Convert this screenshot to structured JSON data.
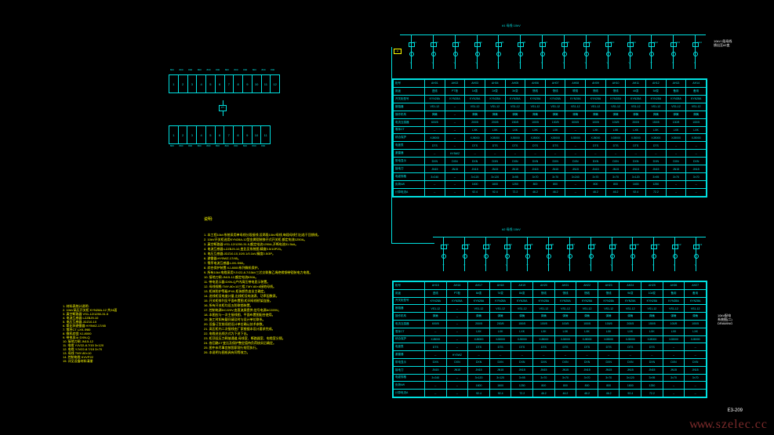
{
  "sheet_no": "E3-209",
  "watermark": "www.szelec.cc",
  "busbar1_title": "#1 母线   10kV",
  "busbar2_title": "#2 母线   10kV",
  "side_title": "10kV配电\n系统图(二)\nDRAWING",
  "panel_top_cells": [
    "1",
    "2",
    "3",
    "4",
    "5",
    "6",
    "7",
    "8",
    "9",
    "10",
    "11",
    "12"
  ],
  "panel_bot_cells": [
    "1",
    "2",
    "3",
    "4",
    "5",
    "6",
    "7",
    "8",
    "9",
    "10",
    "11"
  ],
  "panel_top_dims": [
    "800",
    "800",
    "800",
    "800",
    "800",
    "800",
    "800",
    "800",
    "800",
    "800",
    "800",
    "800"
  ],
  "panel_bot_dims": [
    "800",
    "800",
    "800",
    "800",
    "800",
    "800",
    "800",
    "800",
    "800",
    "800",
    "800"
  ],
  "panel_center": "PT",
  "notes_header": "说明:",
  "notes_lines": [
    "1. 本工程10kV系统采用单母线分段接线,设两段10kV母线,每段母线引出若干回馈线。",
    "2. 10kV开关柜选用KYN28A-12型金属铠装移开式开关柜,额定电流1250A。",
    "3. 真空断路器:VS1-12/1250-31.5,额定电流1250A,开断电流31.5kA。",
    "4. 电流互感器:LZZBJ9-10,变比见系统图,精度0.5/10P20。",
    "5. 电压互感器:JDZ10-10,10/0.1/0.1kV,精度0.5/3P。",
    "6. 避雷器:HY5WZ-17/45。",
    "7. 零序电流互感器:LXK-Φ80。",
    "8. 综合保护装置:XJ-8000系列微机保护。",
    "9. 所有10kV电缆采用YJV22-8.7/15kV三芯交联聚乙烯绝缘钢带铠装电力电缆。",
    "10. 接地刀闸:JN15-12,额定电流630A。",
    "11. 带电显示器:DXN-Q户内高压带电显示装置。",
    "12. 母线规格:TMY-80×10三相,TMY-60×6接地母线。",
    "13. 柜体防护等级IP4X,柜体颜色由业主确定。",
    "14. 进线柜设电度计量,出线柜设电流表、功率因数表。",
    "15. 开关柜排列见平面布置图,柜间母线桥架连接。",
    "16. 所有开关柜均设五防联锁装置。",
    "17. 控制电源DC220V,由直流屏提供;信号电源AC220V。",
    "18. 本图应与一次主接线图、平面布置图配合使用。",
    "19. 施工时如有疑问请及时与设计单位联系。",
    "20. 设备订货前须经设计单位确认技术参数。",
    "21. 高压柜内二次接线由厂家根据本设计要求完成。",
    "22. 电缆进出线方式为下进下出。",
    "23. 柜顶设压力释放通道,母线室、断路器室、电缆室分隔。",
    "24. 各回路CT变比及保护整定值待负荷核实后确定。",
    "25. 图中未尽事宜按国家现行规范执行。",
    "26. 本说明与图纸具有同等效力。"
  ],
  "notes2_lines": [
    "1. 材料表统计说明:",
    "2. 10kV高压开关柜 KYN28A-12 共24面",
    "3. 真空断路器 VS1-12/1250-31.5",
    "4. 电流互感器 LZZBJ9-10",
    "5. 电压互感器 JDZ10-10",
    "6. 氧化锌避雷器 HY5WZ-17/45",
    "7. 零序CT LXK-Φ80",
    "8. 微机综保 XJ-8000",
    "9. 带电显示 DXN-Q",
    "10. 接地刀闸 JN15-12",
    "11. 电缆 YJV22-8.7/15 3×120",
    "12. 电缆 YJV22-8.7/15 3×70",
    "13. 母线 TMY-80×10",
    "14. 控制电缆 KVVP22",
    "15. 详见设备材料清册"
  ],
  "feeder_note": "10kV I段母线\n馈出至#2变",
  "row_headers": [
    "柜号",
    "用途",
    "开关柜型号",
    "断路器",
    "操作机构",
    "电流互感器",
    "零序CT",
    "综合保护",
    "电度表",
    "避雷器",
    "带电显示",
    "接地刀",
    "电缆规格",
    "负荷kW",
    "计算电流A"
  ],
  "table1": {
    "cols": [
      "AH01",
      "AH02",
      "AH03",
      "AH04",
      "AH05",
      "AH06",
      "AH07",
      "AH08",
      "AH09",
      "AH10",
      "AH11",
      "AH12",
      "AH13",
      "AH14"
    ],
    "rows": [
      [
        "进线",
        "PT柜",
        "1#变",
        "2#变",
        "3#变",
        "馈线",
        "馈线",
        "联络",
        "馈线",
        "馈线",
        "4#变",
        "5#变",
        "备用",
        "备用"
      ],
      [
        "KYN28A",
        "KYN28A",
        "KYN28A",
        "KYN28A",
        "KYN28A",
        "KYN28A",
        "KYN28A",
        "KYN28A",
        "KYN28A",
        "KYN28A",
        "KYN28A",
        "KYN28A",
        "KYN28A",
        "KYN28A"
      ],
      [
        "VS1-12",
        "--",
        "VS1-12",
        "VS1-12",
        "VS1-12",
        "VS1-12",
        "VS1-12",
        "VS1-12",
        "VS1-12",
        "VS1-12",
        "VS1-12",
        "VS1-12",
        "VS1-12",
        "VS1-12"
      ],
      [
        "弹簧",
        "--",
        "弹簧",
        "弹簧",
        "弹簧",
        "弹簧",
        "弹簧",
        "弹簧",
        "弹簧",
        "弹簧",
        "弹簧",
        "弹簧",
        "弹簧",
        "弹簧"
      ],
      [
        "600/5",
        "--",
        "200/5",
        "200/5",
        "150/5",
        "100/5",
        "100/5",
        "600/5",
        "100/5",
        "100/5",
        "200/5",
        "150/5",
        "100/5",
        "100/5"
      ],
      [
        "--",
        "--",
        "LXK",
        "LXK",
        "LXK",
        "LXK",
        "LXK",
        "--",
        "LXK",
        "LXK",
        "LXK",
        "LXK",
        "LXK",
        "LXK"
      ],
      [
        "XJ8000",
        "--",
        "XJ8000",
        "XJ8000",
        "XJ8000",
        "XJ8000",
        "XJ8000",
        "XJ8000",
        "XJ8000",
        "XJ8000",
        "XJ8000",
        "XJ8000",
        "XJ8000",
        "XJ8000"
      ],
      [
        "DTS",
        "--",
        "DTS",
        "DTS",
        "DTS",
        "DTS",
        "DTS",
        "--",
        "DTS",
        "DTS",
        "DTS",
        "DTS",
        "--",
        "--"
      ],
      [
        "--",
        "HY5WZ",
        "--",
        "--",
        "--",
        "--",
        "--",
        "--",
        "--",
        "--",
        "--",
        "--",
        "--",
        "--"
      ],
      [
        "DXN",
        "DXN",
        "DXN",
        "DXN",
        "DXN",
        "DXN",
        "DXN",
        "DXN",
        "DXN",
        "DXN",
        "DXN",
        "DXN",
        "DXN",
        "DXN"
      ],
      [
        "JN15",
        "JN15",
        "JN15",
        "JN15",
        "JN15",
        "JN15",
        "JN15",
        "JN15",
        "JN15",
        "JN15",
        "JN15",
        "JN15",
        "JN15",
        "JN15"
      ],
      [
        "3×240",
        "--",
        "3×120",
        "3×120",
        "3×95",
        "3×70",
        "3×70",
        "3×240",
        "3×70",
        "3×70",
        "3×120",
        "3×95",
        "3×70",
        "3×70"
      ],
      [
        "--",
        "--",
        "1600",
        "1600",
        "1250",
        "800",
        "800",
        "--",
        "800",
        "800",
        "1600",
        "1250",
        "--",
        "--"
      ],
      [
        "--",
        "--",
        "92.4",
        "92.4",
        "72.2",
        "46.2",
        "46.2",
        "--",
        "46.2",
        "46.2",
        "92.4",
        "72.2",
        "--",
        "--"
      ]
    ]
  },
  "table2": {
    "cols": [
      "AH15",
      "AH16",
      "AH17",
      "AH18",
      "AH19",
      "AH20",
      "AH21",
      "AH22",
      "AH23",
      "AH24",
      "AH25",
      "AH26",
      "AH27"
    ],
    "rows": [
      [
        "进线",
        "PT柜",
        "6#变",
        "7#变",
        "8#变",
        "馈线",
        "馈线",
        "馈线",
        "馈线",
        "9#变",
        "10#变",
        "备用",
        "备用"
      ],
      [
        "KYN28A",
        "KYN28A",
        "KYN28A",
        "KYN28A",
        "KYN28A",
        "KYN28A",
        "KYN28A",
        "KYN28A",
        "KYN28A",
        "KYN28A",
        "KYN28A",
        "KYN28A",
        "KYN28A"
      ],
      [
        "VS1-12",
        "--",
        "VS1-12",
        "VS1-12",
        "VS1-12",
        "VS1-12",
        "VS1-12",
        "VS1-12",
        "VS1-12",
        "VS1-12",
        "VS1-12",
        "VS1-12",
        "VS1-12"
      ],
      [
        "弹簧",
        "--",
        "弹簧",
        "弹簧",
        "弹簧",
        "弹簧",
        "弹簧",
        "弹簧",
        "弹簧",
        "弹簧",
        "弹簧",
        "弹簧",
        "弹簧"
      ],
      [
        "600/5",
        "--",
        "200/5",
        "200/5",
        "150/5",
        "100/5",
        "100/5",
        "100/5",
        "100/5",
        "200/5",
        "150/5",
        "100/5",
        "100/5"
      ],
      [
        "--",
        "--",
        "LXK",
        "LXK",
        "LXK",
        "LXK",
        "LXK",
        "LXK",
        "LXK",
        "LXK",
        "LXK",
        "LXK",
        "LXK"
      ],
      [
        "XJ8000",
        "--",
        "XJ8000",
        "XJ8000",
        "XJ8000",
        "XJ8000",
        "XJ8000",
        "XJ8000",
        "XJ8000",
        "XJ8000",
        "XJ8000",
        "XJ8000",
        "XJ8000"
      ],
      [
        "DTS",
        "--",
        "DTS",
        "DTS",
        "DTS",
        "DTS",
        "DTS",
        "DTS",
        "DTS",
        "DTS",
        "DTS",
        "--",
        "--"
      ],
      [
        "--",
        "HY5WZ",
        "--",
        "--",
        "--",
        "--",
        "--",
        "--",
        "--",
        "--",
        "--",
        "--",
        "--"
      ],
      [
        "DXN",
        "DXN",
        "DXN",
        "DXN",
        "DXN",
        "DXN",
        "DXN",
        "DXN",
        "DXN",
        "DXN",
        "DXN",
        "DXN",
        "DXN"
      ],
      [
        "JN15",
        "JN15",
        "JN15",
        "JN15",
        "JN15",
        "JN15",
        "JN15",
        "JN15",
        "JN15",
        "JN15",
        "JN15",
        "JN15",
        "JN15"
      ],
      [
        "3×240",
        "--",
        "3×120",
        "3×120",
        "3×95",
        "3×70",
        "3×70",
        "3×70",
        "3×70",
        "3×120",
        "3×95",
        "3×70",
        "3×70"
      ],
      [
        "--",
        "--",
        "1600",
        "1600",
        "1250",
        "800",
        "800",
        "800",
        "800",
        "1600",
        "1250",
        "--",
        "--"
      ],
      [
        "--",
        "--",
        "92.4",
        "92.4",
        "72.2",
        "46.2",
        "46.2",
        "46.2",
        "46.2",
        "92.4",
        "72.2",
        "--",
        "--"
      ]
    ]
  }
}
